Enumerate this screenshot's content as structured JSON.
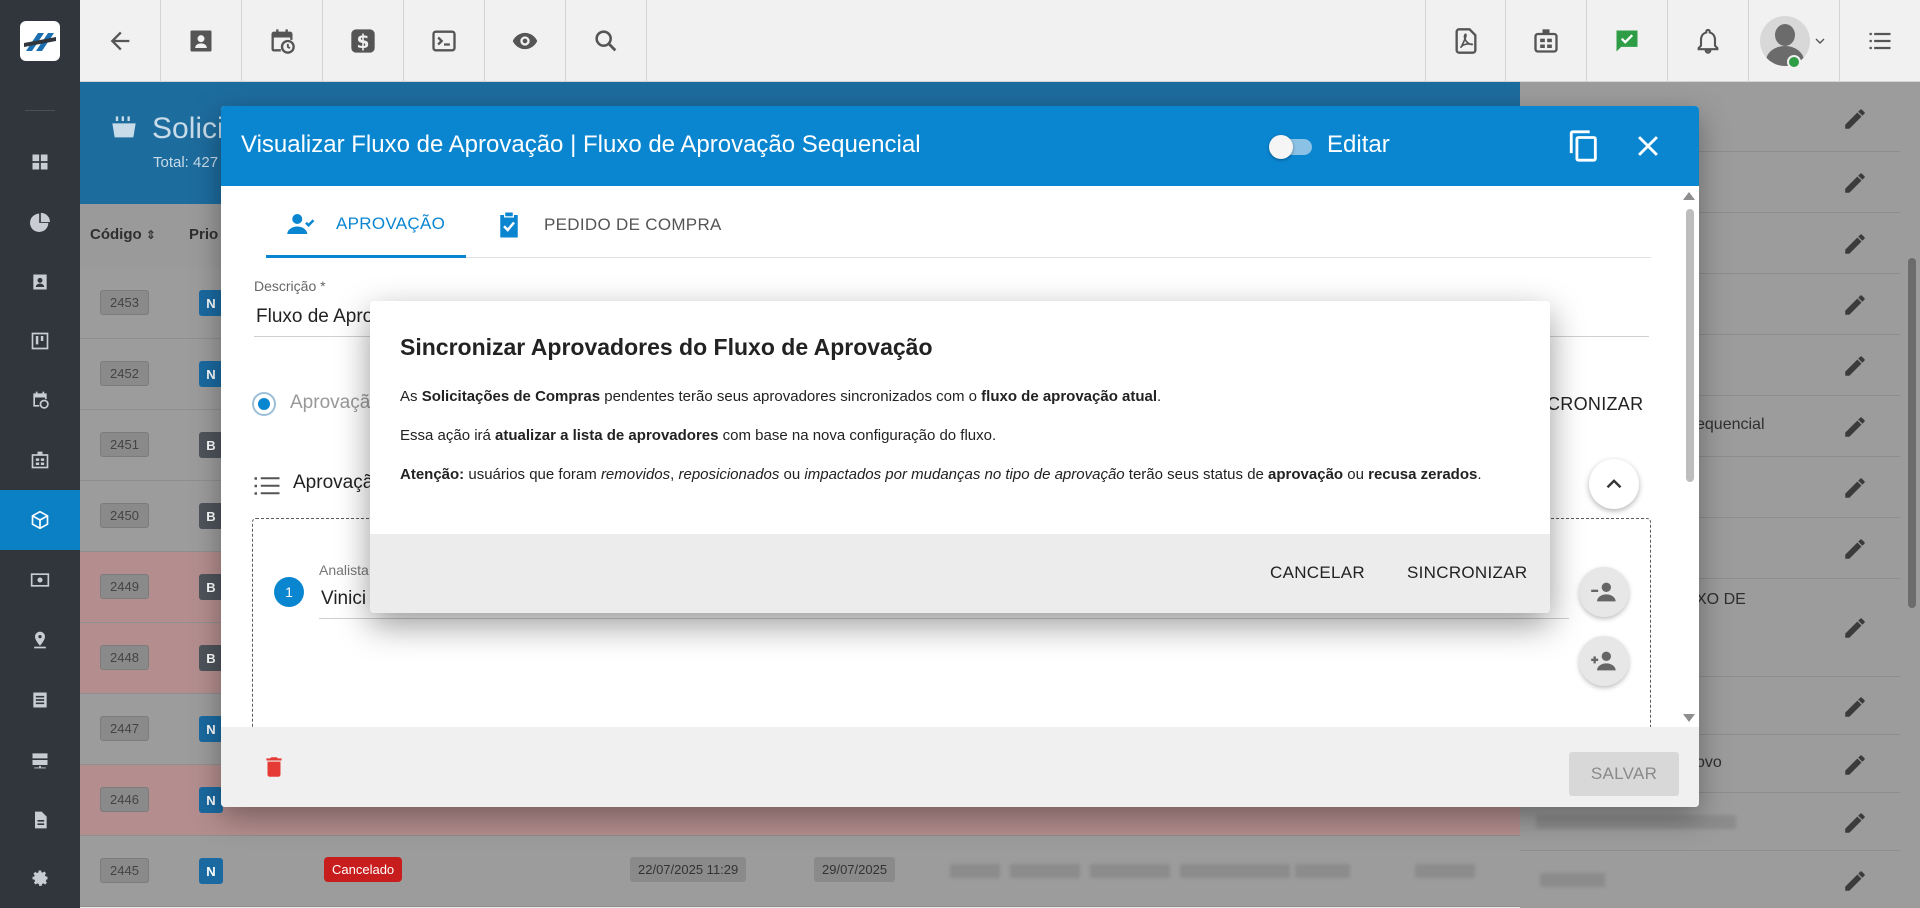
{
  "background_page": {
    "title": "Solici",
    "subtitle": "Total: 427",
    "columns": {
      "code": "Código",
      "priority": "Prio"
    },
    "rows": [
      {
        "code": "2453",
        "priority": "N",
        "tint": "normal"
      },
      {
        "code": "2452",
        "priority": "N",
        "tint": "normal"
      },
      {
        "code": "2451",
        "priority": "B",
        "tint": "normal"
      },
      {
        "code": "2450",
        "priority": "B",
        "tint": "normal"
      },
      {
        "code": "2449",
        "priority": "B",
        "tint": "red"
      },
      {
        "code": "2448",
        "priority": "B",
        "tint": "red"
      },
      {
        "code": "2447",
        "priority": "N",
        "tint": "normal"
      },
      {
        "code": "2446",
        "priority": "N",
        "tint": "red"
      },
      {
        "code": "2445",
        "priority": "N",
        "tint": "normal",
        "status": "Cancelado",
        "date1": "22/07/2025 11:29",
        "date2": "29/07/2025"
      }
    ],
    "right_list": [
      "equencial",
      "XO DE",
      "ovo"
    ]
  },
  "dialog": {
    "title": "Visualizar Fluxo de Aprovação | Fluxo de Aprovação Sequencial",
    "edit_toggle_label": "Editar",
    "tabs": [
      {
        "label": "APROVAÇÃO",
        "icon": "person-check-icon",
        "active": true
      },
      {
        "label": "PEDIDO DE COMPRA",
        "icon": "clipboard-check-icon",
        "active": false
      }
    ],
    "description_label": "Descrição *",
    "description_value": "Fluxo de Apro",
    "radio_label": "Aprovaçã",
    "sync_partial": "CRONIZAR",
    "approvers_section_label": "Aprovaçã",
    "approver": {
      "step": "1",
      "label": "Analista",
      "value": "Vinici"
    },
    "save_label": "SALVAR"
  },
  "confirm": {
    "title": "Sincronizar Aprovadores do Fluxo de Aprovação",
    "p1": {
      "a": "As ",
      "b": "Solicitações de Compras",
      "c": " pendentes terão seus aprovadores sincronizados com o ",
      "d": "fluxo de aprovação atual",
      "e": "."
    },
    "p2": {
      "a": "Essa ação irá ",
      "b": "atualizar a lista de aprovadores",
      "c": " com base na nova configuração do fluxo."
    },
    "p3": {
      "a": "Atenção:",
      "b": " usuários que foram ",
      "c": "removidos",
      "d": ", ",
      "e": "reposicionados",
      "f": " ou ",
      "g": "impactados por mudanças no tipo de aprovação",
      "h": " terão seus status de ",
      "i": "aprovação",
      "j": " ou ",
      "k": "recusa zerados",
      "l": "."
    },
    "cancel_label": "CANCELAR",
    "sync_label": "SINCRONIZAR"
  },
  "colors": {
    "primary": "#0a86d1",
    "sidebar": "#31363d",
    "danger": "#e53a35",
    "online": "#2e9d46"
  }
}
